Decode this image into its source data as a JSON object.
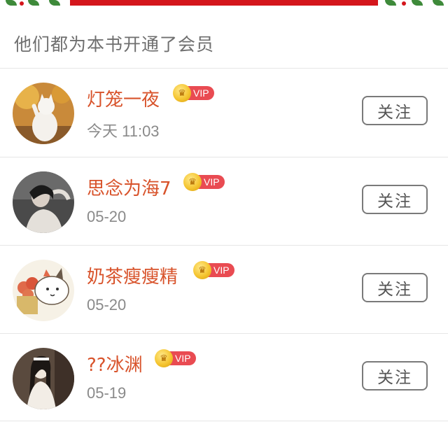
{
  "section_title": "他们都为本书开通了会员",
  "vip_label": "VIP",
  "follow_label": "关注",
  "members": [
    {
      "name": "灯笼一夜",
      "date": "今天 11:03",
      "avatar_icon": "white-cat-avatar"
    },
    {
      "name": "思念为海7",
      "date": "05-20",
      "avatar_icon": "person-photo-avatar"
    },
    {
      "name": "奶茶瘦瘦精",
      "date": "05-20",
      "avatar_icon": "cartoon-cat-avatar"
    },
    {
      "name": "??冰渊",
      "date": "05-19",
      "avatar_icon": "person-photo-avatar"
    }
  ],
  "colors": {
    "name": "#d8532b",
    "vip_tag": "#e94b52",
    "banner": "#d4161c"
  }
}
